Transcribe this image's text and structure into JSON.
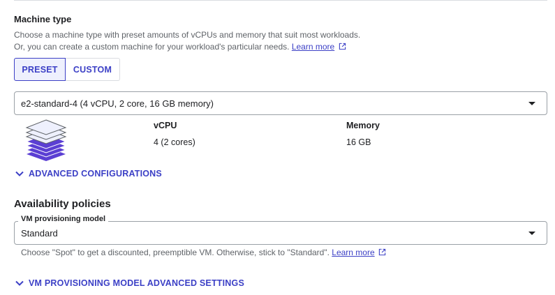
{
  "machine_type": {
    "title": "Machine type",
    "description_line1": "Choose a machine type with preset amounts of vCPUs and memory that suit most workloads.",
    "description_line2": "Or, you can create a custom machine for your workload's particular needs.",
    "learn_more": "Learn more",
    "tabs": [
      "PRESET",
      "CUSTOM"
    ],
    "selected_tab": "PRESET",
    "select_value": "e2-standard-4 (4 vCPU, 2 core, 16 GB memory)",
    "specs": {
      "vcpu_label": "vCPU",
      "vcpu_value": "4 (2 cores)",
      "memory_label": "Memory",
      "memory_value": "16 GB"
    },
    "advanced_configurations": "ADVANCED CONFIGURATIONS"
  },
  "availability": {
    "title": "Availability policies",
    "field_label": "VM provisioning model",
    "field_value": "Standard",
    "hint": "Choose \"Spot\" to get a discounted, preemptible VM. Otherwise, stick to \"Standard\".",
    "learn_more": "Learn more",
    "advanced_settings": "VM PROVISIONING MODEL ADVANCED SETTINGS"
  },
  "colors": {
    "accent": "#3c40c6",
    "stack_light": "#eef0fd",
    "stack_dark": "#5b3fd3"
  }
}
